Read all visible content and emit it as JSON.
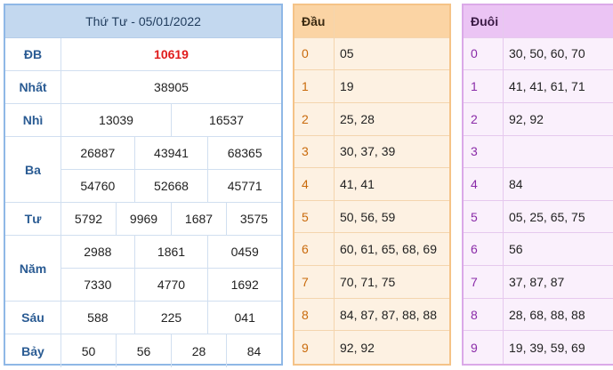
{
  "results": {
    "header": "Thứ Tư - 05/01/2022",
    "rows": [
      {
        "label": "ĐB",
        "lines": [
          [
            "10619"
          ]
        ],
        "special": true
      },
      {
        "label": "Nhất",
        "lines": [
          [
            "38905"
          ]
        ]
      },
      {
        "label": "Nhì",
        "lines": [
          [
            "13039",
            "16537"
          ]
        ]
      },
      {
        "label": "Ba",
        "lines": [
          [
            "26887",
            "43941",
            "68365"
          ],
          [
            "54760",
            "52668",
            "45771"
          ]
        ]
      },
      {
        "label": "Tư",
        "lines": [
          [
            "5792",
            "9969",
            "1687",
            "3575"
          ]
        ]
      },
      {
        "label": "Năm",
        "lines": [
          [
            "2988",
            "1861",
            "0459"
          ],
          [
            "7330",
            "4770",
            "1692"
          ]
        ]
      },
      {
        "label": "Sáu",
        "lines": [
          [
            "588",
            "225",
            "041"
          ]
        ]
      },
      {
        "label": "Bảy",
        "lines": [
          [
            "50",
            "56",
            "28",
            "84"
          ]
        ]
      }
    ]
  },
  "dau": {
    "header": "Đầu",
    "rows": [
      {
        "idx": "0",
        "val": "05"
      },
      {
        "idx": "1",
        "val": "19"
      },
      {
        "idx": "2",
        "val": "25, 28"
      },
      {
        "idx": "3",
        "val": "30, 37, 39"
      },
      {
        "idx": "4",
        "val": "41, 41"
      },
      {
        "idx": "5",
        "val": "50, 56, 59"
      },
      {
        "idx": "6",
        "val": "60, 61, 65, 68, 69"
      },
      {
        "idx": "7",
        "val": "70, 71, 75"
      },
      {
        "idx": "8",
        "val": "84, 87, 87, 88, 88"
      },
      {
        "idx": "9",
        "val": "92, 92"
      }
    ]
  },
  "duoi": {
    "header": "Đuôi",
    "rows": [
      {
        "idx": "0",
        "val": "30, 50, 60, 70"
      },
      {
        "idx": "1",
        "val": "41, 41, 61, 71"
      },
      {
        "idx": "2",
        "val": "92, 92"
      },
      {
        "idx": "3",
        "val": ""
      },
      {
        "idx": "4",
        "val": "84"
      },
      {
        "idx": "5",
        "val": "05, 25, 65, 75"
      },
      {
        "idx": "6",
        "val": "56"
      },
      {
        "idx": "7",
        "val": "37, 87, 87"
      },
      {
        "idx": "8",
        "val": "28, 68, 88, 88"
      },
      {
        "idx": "9",
        "val": "19, 39, 59, 69"
      }
    ]
  },
  "colors": {
    "special_prize": "#e01b1b",
    "results_header_bg": "#c3d8ef",
    "dau_header_bg": "#fbd4a4",
    "duoi_header_bg": "#ebc4f4"
  }
}
